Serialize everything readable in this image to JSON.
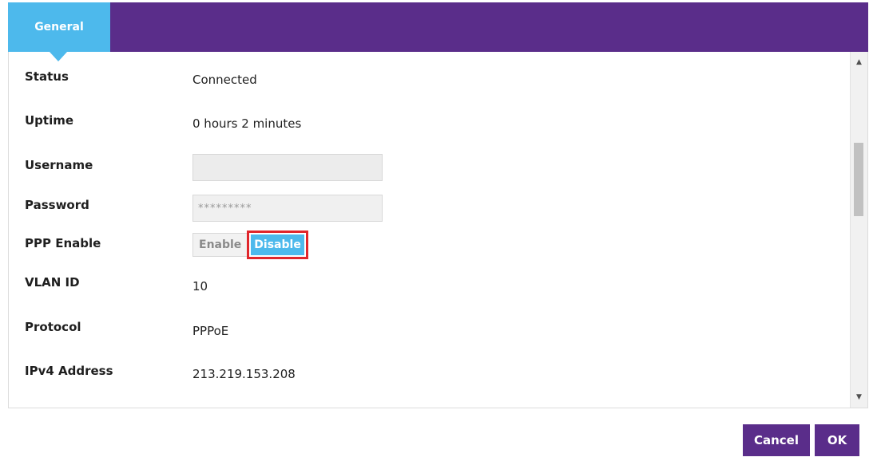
{
  "tabs": [
    {
      "label": "General",
      "active": true
    }
  ],
  "fields": {
    "status": {
      "label": "Status",
      "value": "Connected"
    },
    "uptime": {
      "label": "Uptime",
      "value": "0 hours 2 minutes"
    },
    "username": {
      "label": "Username",
      "value": ""
    },
    "password": {
      "label": "Password",
      "value": "*********"
    },
    "ppp_enable": {
      "label": "PPP Enable",
      "options": [
        "Enable",
        "Disable"
      ],
      "selected": "Disable"
    },
    "vlan_id": {
      "label": "VLAN ID",
      "value": "10"
    },
    "protocol": {
      "label": "Protocol",
      "value": "PPPoE"
    },
    "ipv4": {
      "label": "IPv4 Address",
      "value": "213.219.153.208"
    }
  },
  "buttons": {
    "cancel": "Cancel",
    "ok": "OK"
  },
  "icons": {
    "scroll_up": "triangle-up-icon",
    "scroll_down": "triangle-down-icon"
  },
  "colors": {
    "header_purple": "#5a2d8a",
    "tab_active_blue": "#4db9ec",
    "highlight_red": "#e0262b"
  }
}
